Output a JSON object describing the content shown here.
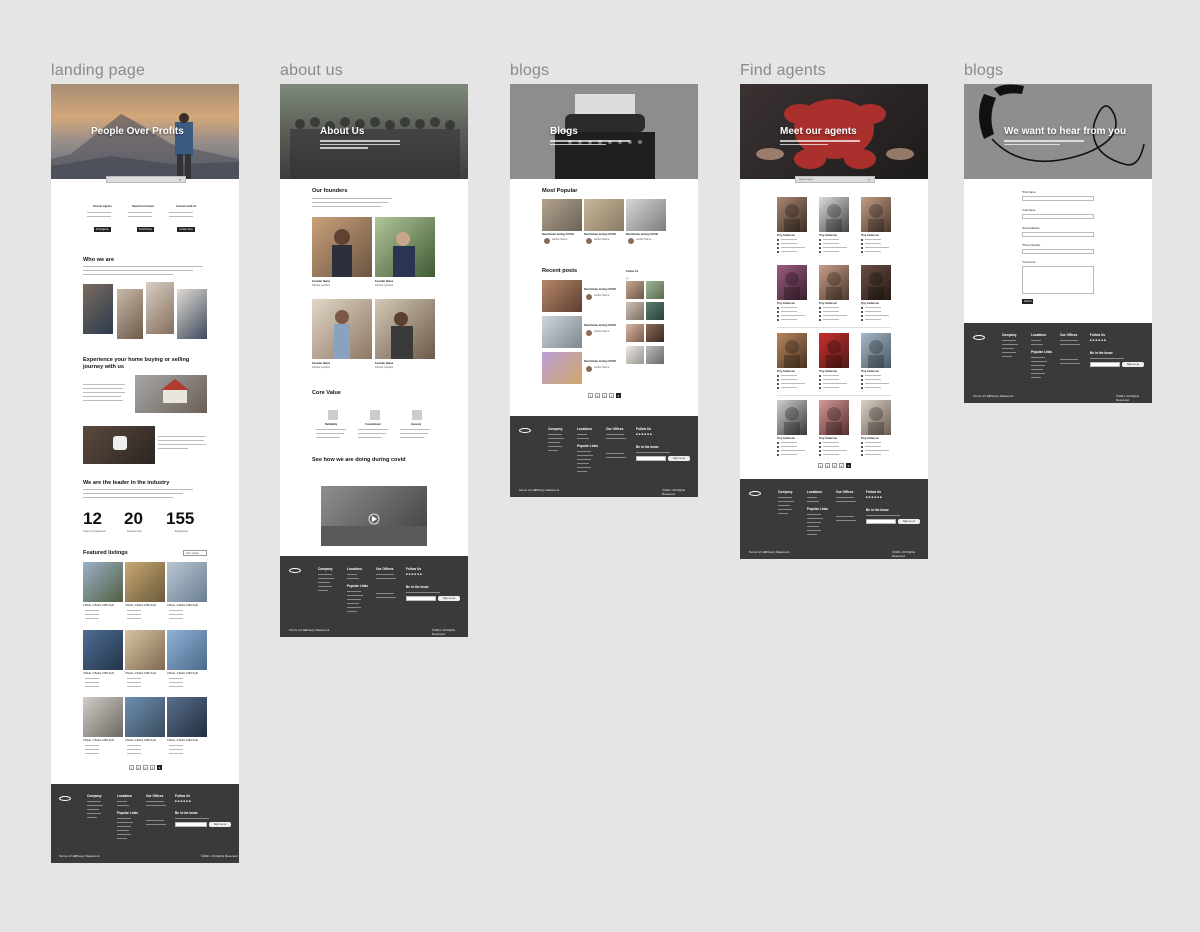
{
  "frames": {
    "landing_label": "landing page",
    "about_label": "about us",
    "blogs_label": "blogs",
    "agents_label": "Find agents",
    "contact_label": "blogs"
  },
  "landing": {
    "hero_title": "People Over Profits",
    "col1_title": "Find an Agents",
    "col2_title": "Search for Homes",
    "col3_title": "Connect with Us",
    "col1_btn": "Find Agents",
    "col2_btn": "Find Homes",
    "col3_btn": "Contact Now",
    "who_title": "Who we are",
    "experience_title": "Experience your home buying or selling journey with us",
    "leader_title": "We are the leader in the industry",
    "stat1": "12",
    "stat2": "20",
    "stat3": "155",
    "stat1_label": "Years of experience",
    "stat2_label": "Houses sold",
    "stat3_label": "Employees",
    "featured_title": "Featured listings",
    "sort_label": "Sort: Latest",
    "listing_text": "3 Beds, 2 Baths 1080 SqFt",
    "pages": [
      "1",
      "2",
      "3",
      "4",
      "5"
    ]
  },
  "about": {
    "hero_title": "About Us",
    "founders_title": "Our founders",
    "founder_name": "Founder Name",
    "founder_role": "Partner position",
    "core_title": "Core Value",
    "core1": "Reliability",
    "core2": "Commitment",
    "core3": "Honesty",
    "covid_title": "See how we are doing during covid"
  },
  "blogs": {
    "hero_title": "Blogs",
    "popular_title": "Most Popular",
    "popular1": "Real Estate during COVID",
    "popular2": "Real Estate during COVID",
    "popular3": "Real Estate during COVID",
    "author": "Author Name",
    "recent_title": "Recent posts",
    "follow_title": "Follow Us",
    "recent1": "Real Estate during COVID",
    "recent2": "Real Estate during COVID",
    "recent3": "Real Estate during COVID",
    "pages": [
      "1",
      "2",
      "3",
      "4",
      "5"
    ]
  },
  "agents": {
    "hero_title": "Meet our agents",
    "search_placeholder": "Search agent",
    "agent_name": "Tiny Anderson",
    "pages": [
      "1",
      "2",
      "3",
      "4",
      "5"
    ]
  },
  "contact": {
    "hero_title": "We want to hear from you",
    "first_name": "*First Name",
    "last_name": "*Last Name",
    "email": "*Email Address",
    "phone": "*Phone Number",
    "comments": "*Comments",
    "submit": "Submit"
  },
  "footer": {
    "company": "Company",
    "locations": "Locations",
    "offices": "Our Offices",
    "follow": "Follow Us",
    "popular_links": "Popular Links",
    "in_know": "Be in the know",
    "signup": "Sign me up",
    "terms": "Terms of Use",
    "privacy": "Privacy Statement",
    "copyright": "©2021. All Rights Reserved"
  },
  "colors": {
    "footer_bg": "#3a3a3a",
    "canvas_bg": "#e5e5e5"
  }
}
